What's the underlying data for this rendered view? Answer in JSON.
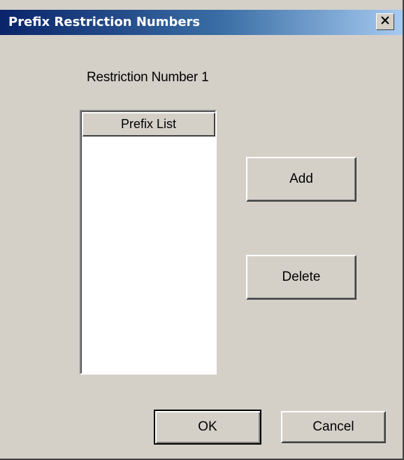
{
  "window": {
    "title": "Prefix Restriction Numbers",
    "close_symbol": "×"
  },
  "restriction_label": "Restriction Number 1",
  "prefix_list": {
    "column_header": "Prefix List",
    "items": []
  },
  "buttons": {
    "add": "Add",
    "delete": "Delete",
    "ok": "OK",
    "cancel": "Cancel"
  },
  "icons": {
    "close": "close-icon"
  }
}
